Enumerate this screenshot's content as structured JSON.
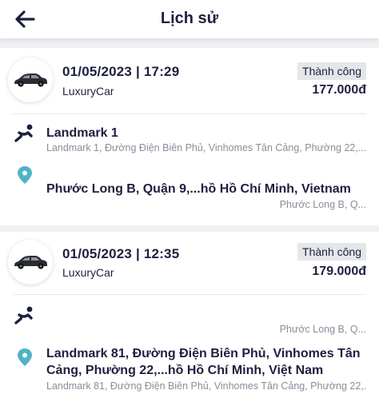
{
  "header": {
    "title": "Lịch sử",
    "back_icon": "arrow-left-icon"
  },
  "colors": {
    "primary": "#1d1f3f",
    "accent_teal": "#4fb3c6",
    "muted": "#8a8d99",
    "badge_bg": "#e4e6ea"
  },
  "trips": [
    {
      "datetime": "01/05/2023 | 17:29",
      "car_type": "LuxuryCar",
      "status": "Thành công",
      "price": "177.000đ",
      "pickup_name": "Landmark 1",
      "pickup_address": "Landmark 1, Đường Điện Biên Phủ, Vinhomes Tân Cảng, Phường 22,...",
      "dest_name": "Phước Long B, Quận 9,...hồ Hồ Chí Minh, Vietnam",
      "dest_address": "Phước Long B, Q..."
    },
    {
      "datetime": "01/05/2023 | 12:35",
      "car_type": "LuxuryCar",
      "status": "Thành công",
      "price": "179.000đ",
      "pickup_name": "",
      "pickup_address": "Phước Long B, Q...",
      "dest_name": "Landmark 81, Đường Điện Biên Phủ, Vinhomes Tân Cảng, Phường 22,...hồ Hồ Chí Minh, Việt Nam",
      "dest_address": "Landmark 81, Đường Điện Biên Phủ, Vinhomes Tân Cảng, Phường 22,..."
    }
  ]
}
